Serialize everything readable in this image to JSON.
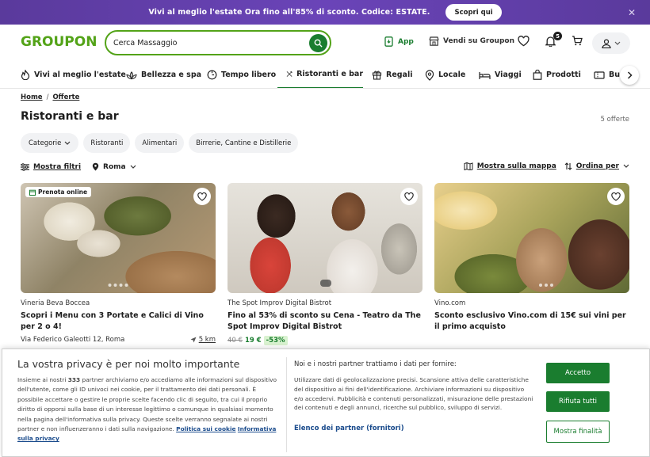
{
  "promo": {
    "text": "Vivi al meglio l'estate Ora fino all'85% di sconto. Codice: ESTATE.",
    "button": "Scopri qui",
    "close": "✕"
  },
  "header": {
    "logo": "GROUPON",
    "search_value": "Cerca Massaggio",
    "app_label": "App",
    "sell_label": "Vendi su Groupon",
    "notification_count": "5"
  },
  "nav": {
    "items": [
      {
        "label": "Vivi al meglio l'estate"
      },
      {
        "label": "Bellezza e spa"
      },
      {
        "label": "Tempo libero"
      },
      {
        "label": "Ristoranti e bar"
      },
      {
        "label": "Regali"
      },
      {
        "label": "Locale"
      },
      {
        "label": "Viaggi"
      },
      {
        "label": "Prodotti"
      },
      {
        "label": "Buo"
      }
    ]
  },
  "breadcrumb": {
    "home": "Home",
    "sep": "/",
    "current": "Offerte"
  },
  "page": {
    "title": "Ristoranti e bar",
    "count": "5 offerte"
  },
  "chips": [
    "Categorie",
    "Ristoranti",
    "Alimentari",
    "Birrerie, Cantine e Distillerie"
  ],
  "filters": {
    "show_filters": "Mostra filtri",
    "location": "Roma",
    "show_map": "Mostra sulla mappa",
    "sort": "Ordina per"
  },
  "cards": [
    {
      "tag": "Prenota online",
      "merchant": "Vineria Beva Boccea",
      "title": "Scopri i Menu con 3 Portate e Calici di Vino per 2 o 4!",
      "address": "Via Federico Galeotti 12, Roma",
      "distance": "5 km"
    },
    {
      "merchant": "The Spot Improv Digital Bistrot",
      "title": "Fino al 53% di sconto su Cena - Teatro da The Spot Improv Digital Bistrot",
      "old_price": "40 €",
      "new_price": "19 €",
      "discount": "-53%"
    },
    {
      "merchant": "Vino.com",
      "title": "Sconto esclusivo Vino.com di 15€ sui vini per il primo acquisto"
    }
  ],
  "privacy": {
    "title": "La vostra privacy è per noi molto importante",
    "body_pre": "Insieme ai nostri ",
    "partner_count": "333",
    "body_post": " partner archiviamo e/o accediamo alle informazioni sul dispositivo dell'utente, come gli ID univoci nei cookie, per il trattamento dei dati personali. È possibile accettare o gestire le proprie scelte facendo clic di seguito, tra cui il proprio diritto di opporsi sulla base di un interesse legittimo o comunque in qualsiasi momento nella pagina dell'informativa sulla privacy. Queste scelte verranno segnalate ai nostri partner e non influenzeranno i dati sulla navigazione.",
    "cookie_link": "Politica sui cookie",
    "privacy_link": "Informativa sulla privacy",
    "right_title": "Noi e i nostri partner trattiamo i dati per fornire:",
    "right_body": "Utilizzare dati di geolocalizzazione precisi. Scansione attiva delle caratteristiche del dispositivo ai fini dell'identificazione. Archiviare informazioni su dispositivo e/o accedervi. Pubblicità e contenuti personalizzati, misurazione delle prestazioni dei contenuti e degli annunci, ricerche sul pubblico, sviluppo di servizi.",
    "partners_link": "Elenco dei partner (fornitori)",
    "accept": "Accetto",
    "reject": "Rifiuta tutti",
    "purposes": "Mostra finalità"
  }
}
